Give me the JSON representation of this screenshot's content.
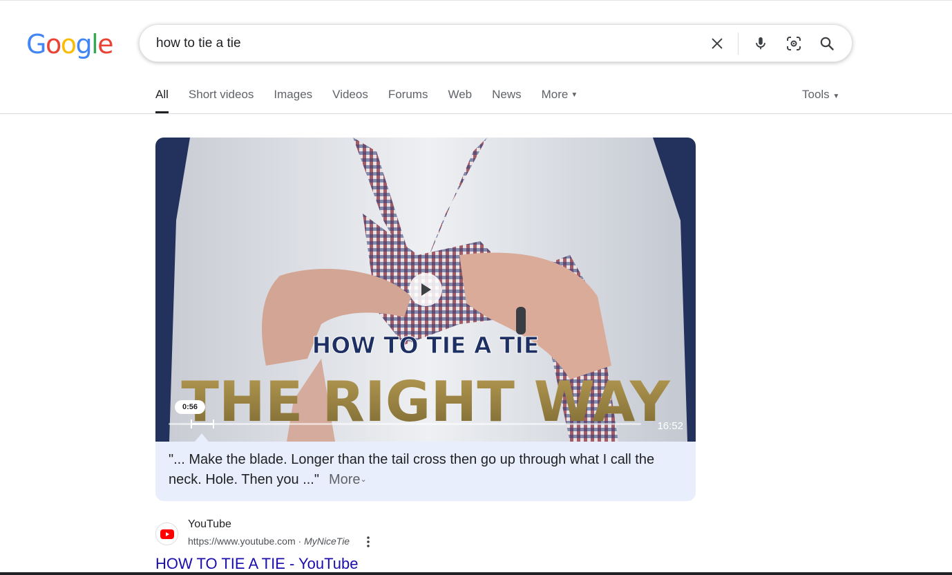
{
  "logo": {
    "text": "Google"
  },
  "search": {
    "query": "how to tie a tie"
  },
  "tabs": [
    {
      "label": "All",
      "active": true
    },
    {
      "label": "Short videos"
    },
    {
      "label": "Images"
    },
    {
      "label": "Videos"
    },
    {
      "label": "Forums"
    },
    {
      "label": "Web"
    },
    {
      "label": "News"
    },
    {
      "label": "More",
      "dropdown": true
    }
  ],
  "tools_label": "Tools",
  "video": {
    "thumbnail_line1": "HOW TO TIE A TIE",
    "thumbnail_line2": "THE RIGHT WAY",
    "current_time": "0:56",
    "duration": "16:52",
    "progress_fraction": 0.055,
    "snippet": "\"... Make the blade. Longer than the tail cross then go up through what I call the neck. Hole. Then you ...\"",
    "more_label": "More"
  },
  "result": {
    "site_name": "YouTube",
    "url": "https://www.youtube.com",
    "separator": "·",
    "author": "MyNiceTie",
    "title": "HOW TO TIE A TIE - YouTube"
  },
  "colors": {
    "link": "#1a0dab",
    "accent_blue": "#4285f4",
    "accent_red": "#ea4335",
    "accent_yellow": "#fbbc05",
    "accent_green": "#34a853",
    "card_bg": "#e8eefb",
    "thumb_bg": "#22325c"
  },
  "icons": [
    "clear-icon",
    "microphone-icon",
    "lens-icon",
    "search-icon",
    "play-icon",
    "chevron-down-icon",
    "youtube-icon",
    "kebab-menu-icon"
  ]
}
